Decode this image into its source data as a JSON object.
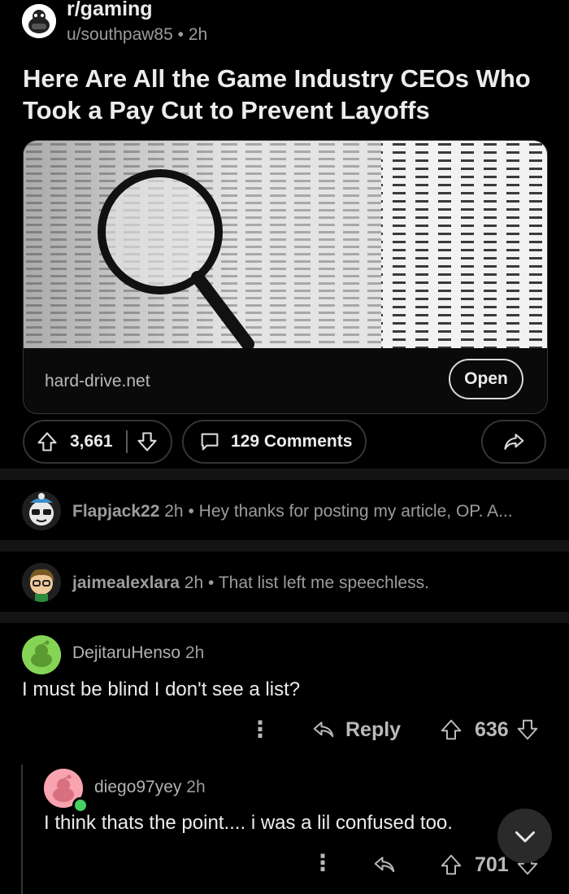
{
  "post": {
    "subreddit": "r/gaming",
    "author": "u/southpaw85",
    "time": "2h",
    "meta_sep": "•",
    "title": "Here Are All the Game Industry CEOs Who Took a Pay Cut to Prevent Layoffs",
    "link_domain": "hard-drive.net",
    "open_label": "Open",
    "score": "3,661",
    "comments_label": "129 Comments"
  },
  "collapsed_comments": [
    {
      "user": "Flapjack22",
      "time": "2h",
      "sep": "•",
      "text": "Hey thanks for posting my article, OP. A..."
    },
    {
      "user": "jaimealexlara",
      "time": "2h",
      "sep": "•",
      "text": "That list left me speechless."
    }
  ],
  "comment": {
    "user": "DejitaruHenso",
    "time": "2h",
    "text": "I must be blind I don't see a list?",
    "more": "⋮",
    "reply_label": "Reply",
    "score": "636"
  },
  "reply": {
    "user": "diego97yey",
    "time": "2h",
    "text": "I think thats the point.... i was a lil confused too.",
    "more": "⋮",
    "score": "701"
  },
  "icons": [
    "upvote-icon",
    "downvote-icon",
    "comment-icon",
    "share-icon",
    "reply-icon",
    "more-icon",
    "chevron-down-icon"
  ],
  "colors": {
    "background": "#000000",
    "card_border": "#343536",
    "text": "#d7dadc",
    "muted": "#8e9093",
    "snoo_green": "#86d455",
    "online_dot": "#46d160"
  }
}
